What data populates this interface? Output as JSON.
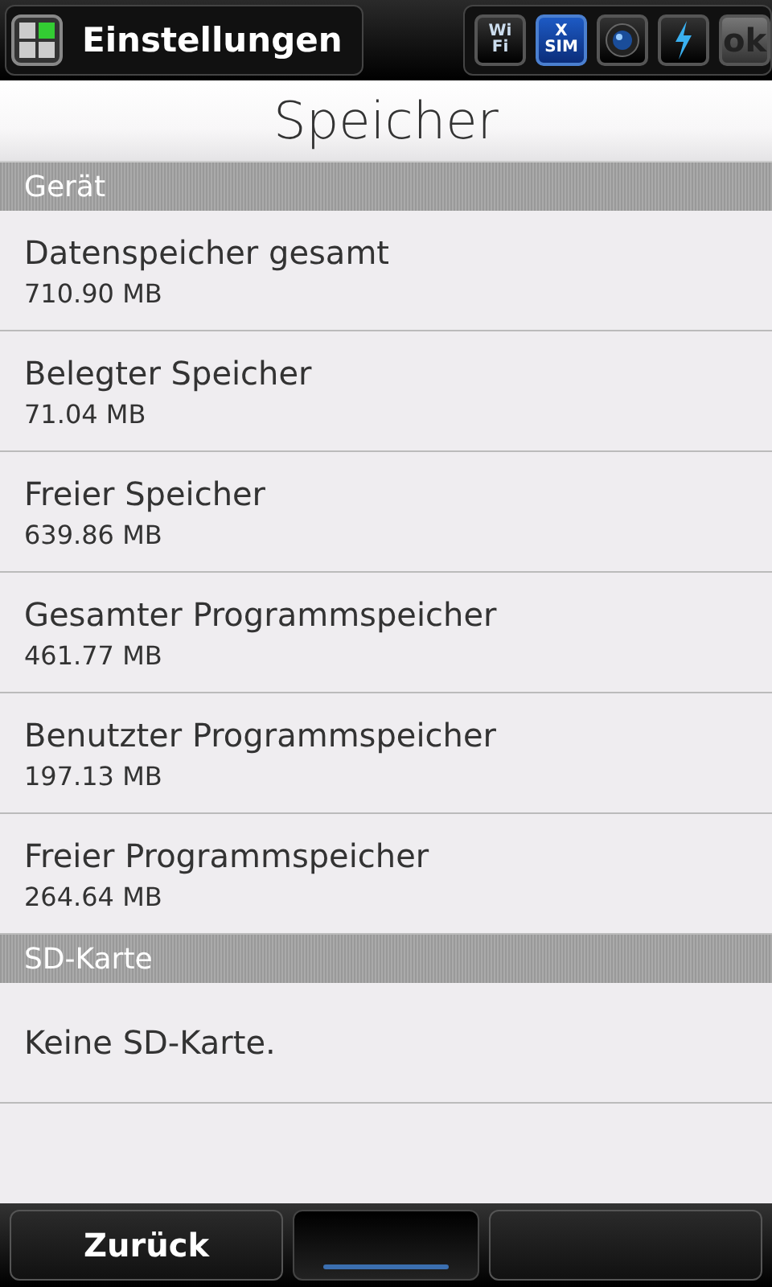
{
  "top_bar": {
    "title": "Einstellungen",
    "tray": [
      {
        "kind": "wifi",
        "texts": [
          "Wi",
          "Fi"
        ],
        "selected": false
      },
      {
        "kind": "sim",
        "texts": [
          "X",
          "SIM"
        ],
        "selected": true
      },
      {
        "kind": "camera",
        "selected": false
      },
      {
        "kind": "bolt",
        "selected": false
      },
      {
        "kind": "ok",
        "texts": [
          "ok"
        ],
        "selected": false
      }
    ]
  },
  "page_title": "Speicher",
  "sections": [
    {
      "header": "Gerät",
      "rows": [
        {
          "label": "Datenspeicher gesamt",
          "value": "710.90 MB"
        },
        {
          "label": "Belegter Speicher",
          "value": "71.04 MB"
        },
        {
          "label": "Freier Speicher",
          "value": "639.86 MB"
        },
        {
          "label": "Gesamter Programmspeicher",
          "value": "461.77 MB"
        },
        {
          "label": "Benutzter Programmspeicher",
          "value": "197.13 MB"
        },
        {
          "label": "Freier Programmspeicher",
          "value": "264.64 MB"
        }
      ]
    },
    {
      "header": "SD-Karte",
      "rows": [
        {
          "label": "Keine SD-Karte."
        }
      ]
    }
  ],
  "bottom_bar": {
    "left": "Zurück"
  }
}
